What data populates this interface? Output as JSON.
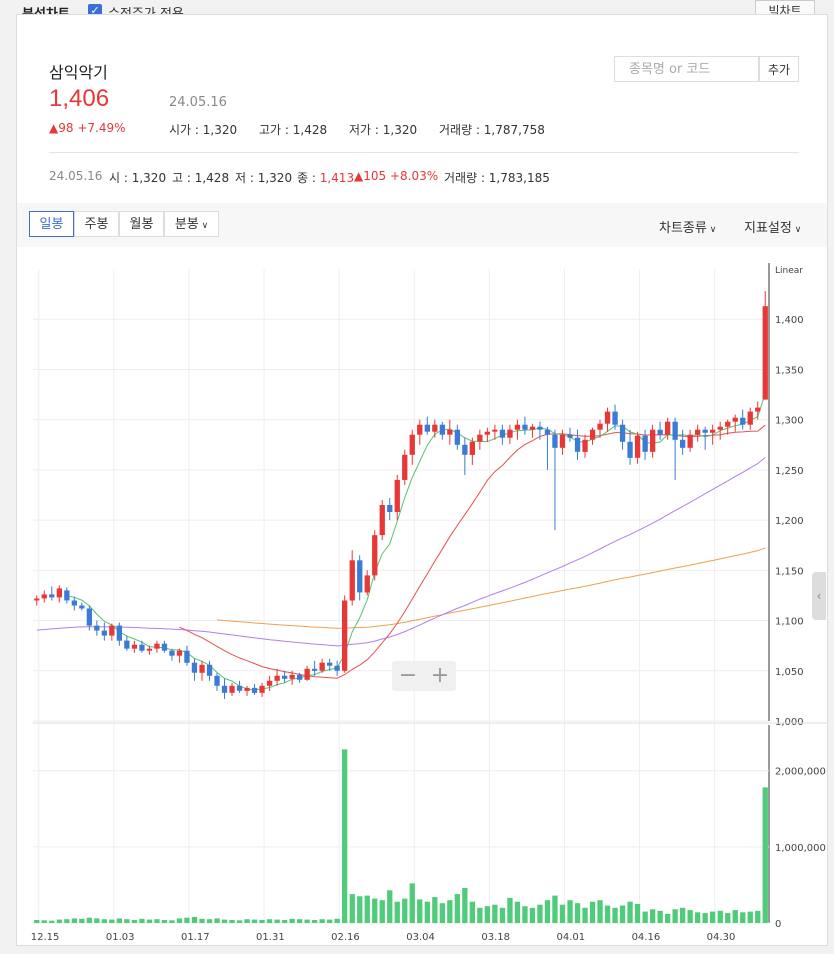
{
  "topbar": {
    "title": "분석차트",
    "checkbox_label": "수정주가 적용",
    "big_chart_label": "빅차트"
  },
  "stock": {
    "name": "삼익악기",
    "price": "1,406",
    "date": "24.05.16",
    "change": "98 +7.49%",
    "open_label": "시가",
    "open": "1,320",
    "high_label": "고가",
    "high": "1,428",
    "low_label": "저가",
    "low": "1,320",
    "volume_label": "거래량",
    "volume": "1,787,758"
  },
  "search": {
    "placeholder": "종목명 or 코드",
    "add_label": "추가"
  },
  "ohlc_line": {
    "date": "24.05.16",
    "o_label": "시",
    "o": "1,320",
    "h_label": "고",
    "h": "1,428",
    "l_label": "저",
    "l": "1,320",
    "c_label": "종",
    "c": "1,413",
    "chg": "105 +8.03%",
    "vol_label": "거래량",
    "vol": "1,783,185"
  },
  "tabs": [
    "일봉",
    "주봉",
    "월봉",
    "분봉"
  ],
  "menus": {
    "chart_type": "차트종류",
    "indicator": "지표설정"
  },
  "colors": {
    "up": "#e83737",
    "down": "#3a7bd5",
    "volume": "#4fcb7a",
    "ma5": "#55c271",
    "ma20": "#e8504e",
    "ma60": "#b07ef0",
    "ma120": "#f0a050"
  },
  "chart_data": {
    "type": "candlestick",
    "scale_label": "Linear",
    "price_ticks": [
      1000,
      1050,
      1100,
      1150,
      1200,
      1250,
      1300,
      1350,
      1400
    ],
    "price_tick_labels": [
      "1,000",
      "1,050",
      "1,100",
      "1,150",
      "1,200",
      "1,250",
      "1,300",
      "1,350",
      "1,400"
    ],
    "ylim": [
      1000,
      1450
    ],
    "volume_ticks": [
      0,
      1000000,
      2000000
    ],
    "volume_tick_labels": [
      "0",
      "1,000,000",
      "2,000,000"
    ],
    "volume_ylim": [
      0,
      2600000
    ],
    "x_tick_labels": [
      {
        "i": 1,
        "label": "12.15"
      },
      {
        "i": 11,
        "label": "01.03"
      },
      {
        "i": 21,
        "label": "01.17"
      },
      {
        "i": 31,
        "label": "01.31"
      },
      {
        "i": 41,
        "label": "02.16"
      },
      {
        "i": 51,
        "label": "03.04"
      },
      {
        "i": 61,
        "label": "03.18"
      },
      {
        "i": 71,
        "label": "04.01"
      },
      {
        "i": 81,
        "label": "04.16"
      },
      {
        "i": 91,
        "label": "04.30"
      }
    ],
    "candles": [
      [
        1120,
        1125,
        1115,
        1122
      ],
      [
        1122,
        1130,
        1118,
        1126
      ],
      [
        1126,
        1134,
        1120,
        1123
      ],
      [
        1123,
        1135,
        1118,
        1132
      ],
      [
        1130,
        1133,
        1117,
        1120
      ],
      [
        1120,
        1124,
        1110,
        1115
      ],
      [
        1115,
        1118,
        1110,
        1112
      ],
      [
        1112,
        1115,
        1090,
        1095
      ],
      [
        1095,
        1100,
        1085,
        1090
      ],
      [
        1090,
        1098,
        1080,
        1085
      ],
      [
        1085,
        1097,
        1080,
        1095
      ],
      [
        1095,
        1098,
        1075,
        1080
      ],
      [
        1080,
        1085,
        1070,
        1072
      ],
      [
        1072,
        1080,
        1068,
        1076
      ],
      [
        1076,
        1080,
        1068,
        1070
      ],
      [
        1070,
        1075,
        1066,
        1072
      ],
      [
        1072,
        1080,
        1068,
        1077
      ],
      [
        1077,
        1080,
        1068,
        1070
      ],
      [
        1070,
        1072,
        1060,
        1065
      ],
      [
        1065,
        1072,
        1058,
        1070
      ],
      [
        1070,
        1075,
        1055,
        1058
      ],
      [
        1058,
        1062,
        1040,
        1048
      ],
      [
        1048,
        1060,
        1040,
        1056
      ],
      [
        1056,
        1060,
        1040,
        1045
      ],
      [
        1045,
        1048,
        1030,
        1035
      ],
      [
        1035,
        1042,
        1022,
        1028
      ],
      [
        1028,
        1038,
        1025,
        1035
      ],
      [
        1035,
        1040,
        1028,
        1030
      ],
      [
        1030,
        1035,
        1025,
        1033
      ],
      [
        1033,
        1037,
        1026,
        1028
      ],
      [
        1028,
        1038,
        1024,
        1035
      ],
      [
        1035,
        1045,
        1030,
        1040
      ],
      [
        1040,
        1052,
        1035,
        1045
      ],
      [
        1045,
        1050,
        1038,
        1042
      ],
      [
        1042,
        1050,
        1036,
        1046
      ],
      [
        1046,
        1048,
        1038,
        1041
      ],
      [
        1041,
        1055,
        1040,
        1052
      ],
      [
        1052,
        1060,
        1045,
        1050
      ],
      [
        1050,
        1062,
        1048,
        1058
      ],
      [
        1058,
        1062,
        1050,
        1055
      ],
      [
        1055,
        1060,
        1045,
        1050
      ],
      [
        1050,
        1125,
        1048,
        1120
      ],
      [
        1120,
        1170,
        1115,
        1160
      ],
      [
        1160,
        1165,
        1120,
        1128
      ],
      [
        1128,
        1150,
        1125,
        1145
      ],
      [
        1145,
        1190,
        1140,
        1185
      ],
      [
        1185,
        1220,
        1180,
        1215
      ],
      [
        1215,
        1222,
        1200,
        1208
      ],
      [
        1208,
        1245,
        1200,
        1240
      ],
      [
        1240,
        1270,
        1235,
        1265
      ],
      [
        1265,
        1290,
        1255,
        1285
      ],
      [
        1285,
        1300,
        1275,
        1295
      ],
      [
        1295,
        1303,
        1285,
        1288
      ],
      [
        1288,
        1300,
        1282,
        1295
      ],
      [
        1295,
        1298,
        1280,
        1285
      ],
      [
        1285,
        1300,
        1275,
        1290
      ],
      [
        1290,
        1295,
        1270,
        1275
      ],
      [
        1275,
        1282,
        1245,
        1265
      ],
      [
        1265,
        1282,
        1255,
        1278
      ],
      [
        1278,
        1290,
        1270,
        1285
      ],
      [
        1285,
        1292,
        1278,
        1288
      ],
      [
        1288,
        1295,
        1280,
        1290
      ],
      [
        1290,
        1295,
        1275,
        1282
      ],
      [
        1282,
        1295,
        1276,
        1290
      ],
      [
        1290,
        1300,
        1280,
        1295
      ],
      [
        1295,
        1303,
        1285,
        1290
      ],
      [
        1290,
        1296,
        1282,
        1293
      ],
      [
        1293,
        1298,
        1280,
        1290
      ],
      [
        1290,
        1293,
        1250,
        1285
      ],
      [
        1285,
        1290,
        1190,
        1272
      ],
      [
        1272,
        1290,
        1265,
        1285
      ],
      [
        1285,
        1292,
        1278,
        1282
      ],
      [
        1282,
        1290,
        1260,
        1268
      ],
      [
        1268,
        1285,
        1262,
        1280
      ],
      [
        1280,
        1292,
        1275,
        1290
      ],
      [
        1290,
        1300,
        1282,
        1296
      ],
      [
        1296,
        1312,
        1288,
        1308
      ],
      [
        1308,
        1315,
        1290,
        1295
      ],
      [
        1295,
        1300,
        1270,
        1278
      ],
      [
        1278,
        1290,
        1255,
        1262
      ],
      [
        1262,
        1288,
        1256,
        1284
      ],
      [
        1284,
        1290,
        1260,
        1268
      ],
      [
        1268,
        1295,
        1262,
        1290
      ],
      [
        1290,
        1298,
        1280,
        1285
      ],
      [
        1285,
        1302,
        1280,
        1298
      ],
      [
        1298,
        1302,
        1240,
        1280
      ],
      [
        1280,
        1290,
        1265,
        1272
      ],
      [
        1272,
        1290,
        1268,
        1285
      ],
      [
        1285,
        1295,
        1278,
        1290
      ],
      [
        1290,
        1293,
        1270,
        1287
      ],
      [
        1287,
        1295,
        1275,
        1290
      ],
      [
        1290,
        1298,
        1280,
        1293
      ],
      [
        1293,
        1300,
        1285,
        1298
      ],
      [
        1298,
        1305,
        1288,
        1302
      ],
      [
        1302,
        1310,
        1290,
        1295
      ],
      [
        1295,
        1312,
        1290,
        1308
      ],
      [
        1308,
        1318,
        1300,
        1312
      ],
      [
        1320,
        1428,
        1320,
        1413
      ]
    ],
    "volumes": [
      40000,
      35000,
      30000,
      45000,
      50000,
      60000,
      55000,
      70000,
      60000,
      50000,
      45000,
      60000,
      50000,
      40000,
      55000,
      45000,
      50000,
      40000,
      35000,
      60000,
      70000,
      80000,
      55000,
      50000,
      60000,
      45000,
      40000,
      35000,
      50000,
      45000,
      40000,
      50000,
      45000,
      40000,
      55000,
      50000,
      45000,
      40000,
      50000,
      45000,
      55000,
      2280000,
      380000,
      350000,
      360000,
      320000,
      300000,
      430000,
      280000,
      320000,
      520000,
      310000,
      280000,
      340000,
      260000,
      300000,
      380000,
      460000,
      280000,
      200000,
      220000,
      240000,
      200000,
      330000,
      280000,
      220000,
      200000,
      240000,
      300000,
      360000,
      240000,
      300000,
      260000,
      200000,
      280000,
      300000,
      230000,
      200000,
      230000,
      280000,
      250000,
      150000,
      180000,
      160000,
      120000,
      180000,
      200000,
      170000,
      140000,
      130000,
      150000,
      160000,
      130000,
      170000,
      140000,
      150000,
      160000,
      1780000
    ],
    "ma": [
      {
        "name": "5",
        "color": "#55c271",
        "start": 4,
        "points": []
      },
      {
        "name": "20",
        "color": "#e8504e"
      },
      {
        "name": "60",
        "color": "#b07ef0"
      },
      {
        "name": "120",
        "color": "#f0a050"
      }
    ]
  }
}
